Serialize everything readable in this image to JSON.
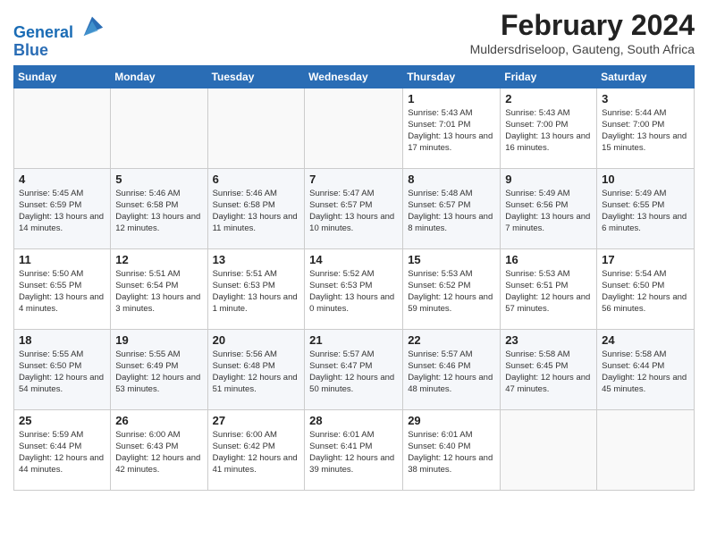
{
  "logo": {
    "line1": "General",
    "line2": "Blue"
  },
  "title": "February 2024",
  "subtitle": "Muldersdriseloop, Gauteng, South Africa",
  "days_of_week": [
    "Sunday",
    "Monday",
    "Tuesday",
    "Wednesday",
    "Thursday",
    "Friday",
    "Saturday"
  ],
  "weeks": [
    [
      {
        "day": "",
        "info": ""
      },
      {
        "day": "",
        "info": ""
      },
      {
        "day": "",
        "info": ""
      },
      {
        "day": "",
        "info": ""
      },
      {
        "day": "1",
        "info": "Sunrise: 5:43 AM\nSunset: 7:01 PM\nDaylight: 13 hours\nand 17 minutes."
      },
      {
        "day": "2",
        "info": "Sunrise: 5:43 AM\nSunset: 7:00 PM\nDaylight: 13 hours\nand 16 minutes."
      },
      {
        "day": "3",
        "info": "Sunrise: 5:44 AM\nSunset: 7:00 PM\nDaylight: 13 hours\nand 15 minutes."
      }
    ],
    [
      {
        "day": "4",
        "info": "Sunrise: 5:45 AM\nSunset: 6:59 PM\nDaylight: 13 hours\nand 14 minutes."
      },
      {
        "day": "5",
        "info": "Sunrise: 5:46 AM\nSunset: 6:58 PM\nDaylight: 13 hours\nand 12 minutes."
      },
      {
        "day": "6",
        "info": "Sunrise: 5:46 AM\nSunset: 6:58 PM\nDaylight: 13 hours\nand 11 minutes."
      },
      {
        "day": "7",
        "info": "Sunrise: 5:47 AM\nSunset: 6:57 PM\nDaylight: 13 hours\nand 10 minutes."
      },
      {
        "day": "8",
        "info": "Sunrise: 5:48 AM\nSunset: 6:57 PM\nDaylight: 13 hours\nand 8 minutes."
      },
      {
        "day": "9",
        "info": "Sunrise: 5:49 AM\nSunset: 6:56 PM\nDaylight: 13 hours\nand 7 minutes."
      },
      {
        "day": "10",
        "info": "Sunrise: 5:49 AM\nSunset: 6:55 PM\nDaylight: 13 hours\nand 6 minutes."
      }
    ],
    [
      {
        "day": "11",
        "info": "Sunrise: 5:50 AM\nSunset: 6:55 PM\nDaylight: 13 hours\nand 4 minutes."
      },
      {
        "day": "12",
        "info": "Sunrise: 5:51 AM\nSunset: 6:54 PM\nDaylight: 13 hours\nand 3 minutes."
      },
      {
        "day": "13",
        "info": "Sunrise: 5:51 AM\nSunset: 6:53 PM\nDaylight: 13 hours\nand 1 minute."
      },
      {
        "day": "14",
        "info": "Sunrise: 5:52 AM\nSunset: 6:53 PM\nDaylight: 13 hours\nand 0 minutes."
      },
      {
        "day": "15",
        "info": "Sunrise: 5:53 AM\nSunset: 6:52 PM\nDaylight: 12 hours\nand 59 minutes."
      },
      {
        "day": "16",
        "info": "Sunrise: 5:53 AM\nSunset: 6:51 PM\nDaylight: 12 hours\nand 57 minutes."
      },
      {
        "day": "17",
        "info": "Sunrise: 5:54 AM\nSunset: 6:50 PM\nDaylight: 12 hours\nand 56 minutes."
      }
    ],
    [
      {
        "day": "18",
        "info": "Sunrise: 5:55 AM\nSunset: 6:50 PM\nDaylight: 12 hours\nand 54 minutes."
      },
      {
        "day": "19",
        "info": "Sunrise: 5:55 AM\nSunset: 6:49 PM\nDaylight: 12 hours\nand 53 minutes."
      },
      {
        "day": "20",
        "info": "Sunrise: 5:56 AM\nSunset: 6:48 PM\nDaylight: 12 hours\nand 51 minutes."
      },
      {
        "day": "21",
        "info": "Sunrise: 5:57 AM\nSunset: 6:47 PM\nDaylight: 12 hours\nand 50 minutes."
      },
      {
        "day": "22",
        "info": "Sunrise: 5:57 AM\nSunset: 6:46 PM\nDaylight: 12 hours\nand 48 minutes."
      },
      {
        "day": "23",
        "info": "Sunrise: 5:58 AM\nSunset: 6:45 PM\nDaylight: 12 hours\nand 47 minutes."
      },
      {
        "day": "24",
        "info": "Sunrise: 5:58 AM\nSunset: 6:44 PM\nDaylight: 12 hours\nand 45 minutes."
      }
    ],
    [
      {
        "day": "25",
        "info": "Sunrise: 5:59 AM\nSunset: 6:44 PM\nDaylight: 12 hours\nand 44 minutes."
      },
      {
        "day": "26",
        "info": "Sunrise: 6:00 AM\nSunset: 6:43 PM\nDaylight: 12 hours\nand 42 minutes."
      },
      {
        "day": "27",
        "info": "Sunrise: 6:00 AM\nSunset: 6:42 PM\nDaylight: 12 hours\nand 41 minutes."
      },
      {
        "day": "28",
        "info": "Sunrise: 6:01 AM\nSunset: 6:41 PM\nDaylight: 12 hours\nand 39 minutes."
      },
      {
        "day": "29",
        "info": "Sunrise: 6:01 AM\nSunset: 6:40 PM\nDaylight: 12 hours\nand 38 minutes."
      },
      {
        "day": "",
        "info": ""
      },
      {
        "day": "",
        "info": ""
      }
    ]
  ]
}
